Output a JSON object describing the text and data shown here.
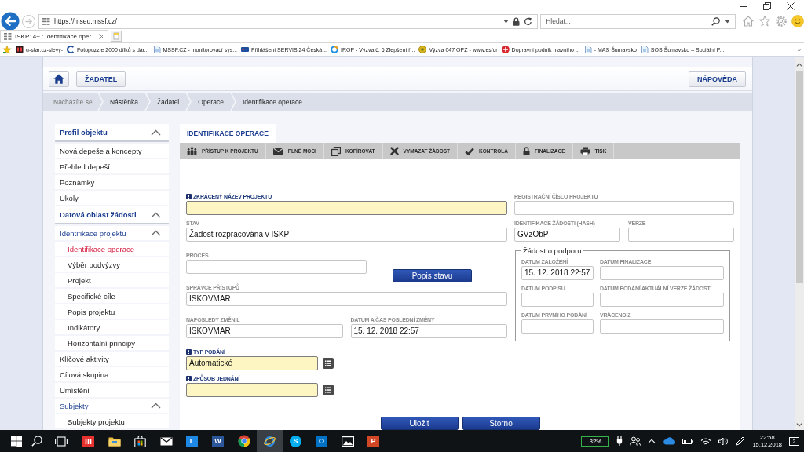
{
  "browser": {
    "address": {
      "value": "https://mseu.mssf.cz/"
    },
    "search": {
      "placeholder": "Hledat..."
    },
    "tabs": [
      {
        "label": "ISKP14+ : Identifikace oper...",
        "selected": true
      }
    ],
    "favorites": [
      {
        "label": "u-star.cz-slevy-"
      },
      {
        "label": "Fotopuzzle 2000 dílků s dár..."
      },
      {
        "label": "MSSF.CZ - monitorovací sys..."
      },
      {
        "label": "Přihlášení SERVIS 24 Česká..."
      },
      {
        "label": "IROP - Výzva č. 6 Zlepšení ř..."
      },
      {
        "label": "Výzva 047 OPZ - www.esfcr"
      },
      {
        "label": "Dopravní podnik hlavního ..."
      },
      {
        "label": "- MAS Šumavsko"
      },
      {
        "label": "SOS Šumavsko – Sociální P..."
      }
    ],
    "favorites_overflow": "»"
  },
  "header": {
    "section_button": "ŽADATEL",
    "help_button": "NÁPOVĚDA"
  },
  "breadcrumb": {
    "label": "Nacházíte se:",
    "items": [
      "Nástěnka",
      "Žadatel",
      "Operace",
      "Identifikace operace"
    ]
  },
  "sidebar": {
    "items": [
      {
        "label": "Profil objektu",
        "selected": false,
        "expanded": true,
        "children": [
          {
            "label": "Nová depeše a koncepty",
            "selected": false
          },
          {
            "label": "Přehled depeší",
            "selected": false
          },
          {
            "label": "Poznámky",
            "selected": false
          },
          {
            "label": "Úkoly",
            "selected": false
          }
        ]
      },
      {
        "label": "Datová oblast žádosti",
        "selected": false,
        "expanded": true,
        "children": [
          {
            "label": "Identifikace projektu",
            "selected": false,
            "expanded": true,
            "children": [
              {
                "label": "Identifikace operace",
                "selected": true
              },
              {
                "label": "Výběr podvýzvy",
                "selected": false
              },
              {
                "label": "Projekt",
                "selected": false
              },
              {
                "label": "Specifické cíle",
                "selected": false
              },
              {
                "label": "Popis projektu",
                "selected": false
              },
              {
                "label": "Indikátory",
                "selected": false
              },
              {
                "label": "Horizontální principy",
                "selected": false
              }
            ]
          },
          {
            "label": "Klíčové aktivity",
            "selected": false
          },
          {
            "label": "Cílová skupina",
            "selected": false
          },
          {
            "label": "Umístění",
            "selected": false
          },
          {
            "label": "Subjekty",
            "selected": false,
            "expanded": true,
            "children": [
              {
                "label": "Subjekty projektu",
                "selected": false
              }
            ]
          }
        ]
      }
    ]
  },
  "panel": {
    "tabs": [
      {
        "label": "IDENTIFIKACE OPERACE",
        "selected": true
      }
    ],
    "toolbar": [
      "PŘÍSTUP K PROJEKTU",
      "PLNÉ MOCI",
      "KOPÍROVAT",
      "VYMAZAT ŽÁDOST",
      "KONTROLA",
      "FINALIZACE",
      "TISK"
    ],
    "form": {
      "left_rows": [
        [
          {
            "kind": "text",
            "label": "ZKRÁCENÝ NÁZEV PROJEKTU",
            "required": true
          }
        ],
        [
          {
            "kind": "text",
            "label": "STAV",
            "value": "Žádost rozpracována v ISKP",
            "required": false
          }
        ],
        [
          {
            "kind": "text",
            "label": "PROCES",
            "required": false
          },
          {
            "kind": "button",
            "label": "Popis stavu"
          }
        ],
        [
          {
            "kind": "text",
            "label": "SPRÁVCE PŘÍSTUPŮ",
            "value": "ISKOVMAR",
            "required": false
          }
        ],
        [
          {
            "kind": "text",
            "label": "NAPOSLEDY ZMĚNIL",
            "value": "ISKOVMAR",
            "required": false
          },
          {
            "kind": "text",
            "label": "DATUM A ČAS POSLEDNÍ ZMĚNY",
            "value": "15. 12. 2018 22:57",
            "required": false
          }
        ],
        [
          {
            "kind": "select",
            "label": "TYP PODÁNÍ",
            "value": "Automatické",
            "required": true
          }
        ],
        [
          {
            "kind": "select",
            "label": "ZPŮSOB JEDNÁNÍ",
            "required": true
          }
        ]
      ],
      "right_rows": [
        [
          {
            "kind": "text",
            "label": "REGISTRAČNÍ ČÍSLO PROJEKTU",
            "required": false
          }
        ],
        [
          {
            "kind": "text",
            "label": "IDENTIFIKACE ŽÁDOSTI (HASH)",
            "value": "GVzObP",
            "required": false
          },
          {
            "kind": "text",
            "label": "VERZE",
            "required": false
          }
        ]
      ],
      "group": {
        "title": "Žádost o podporu",
        "fields": [
          {
            "label": "DATUM ZALOŽENÍ",
            "value": "15. 12. 2018 22:57"
          },
          {
            "label": "DATUM FINALIZACE"
          },
          {
            "label": "DATUM PODPISU"
          },
          {
            "label": "DATUM PODÁNÍ AKTUÁLNÍ VERZE ŽÁDOSTI"
          },
          {
            "label": "DATUM PRVNÍHO PODÁNÍ"
          },
          {
            "label": "VRÁCENO Z"
          }
        ]
      }
    },
    "buttons": [
      "Uložit",
      "Storno"
    ]
  },
  "taskbar": {
    "apps": [
      {
        "kind": "icon",
        "selected": false
      },
      {
        "kind": "icon",
        "selected": false
      },
      {
        "kind": "icon",
        "selected": false
      },
      {
        "kind": "icon",
        "selected": false
      },
      {
        "kind": "letter",
        "label": "L",
        "selected": false
      },
      {
        "kind": "letter",
        "label": "W",
        "selected": false
      },
      {
        "kind": "icon",
        "selected": false
      },
      {
        "kind": "icon",
        "selected": true
      },
      {
        "kind": "letter",
        "label": "S",
        "selected": false
      },
      {
        "kind": "letter",
        "label": "O",
        "selected": false
      },
      {
        "kind": "icon",
        "selected": false
      },
      {
        "kind": "letter",
        "label": "P",
        "selected": false
      }
    ],
    "battery": "32%",
    "time": "22:58",
    "date": "15.12.2018",
    "notifications": "2"
  }
}
